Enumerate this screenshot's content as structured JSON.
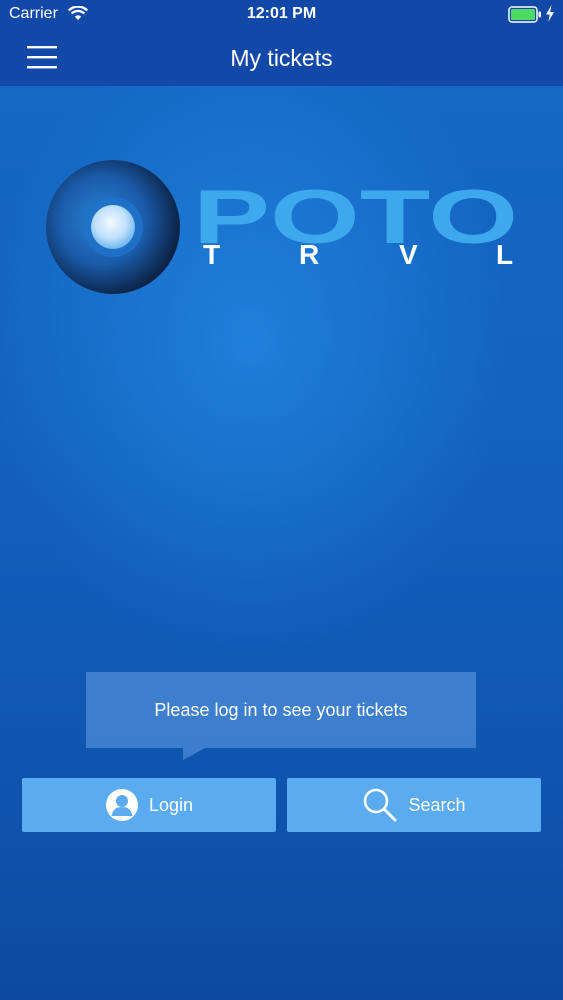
{
  "status_bar": {
    "carrier": "Carrier",
    "time": "12:01 PM"
  },
  "nav": {
    "title": "My tickets"
  },
  "logo": {
    "wordmark": "POTO",
    "letters": [
      "T",
      "R",
      "V",
      "L"
    ]
  },
  "tooltip": {
    "text": "Please log in to see your tickets"
  },
  "buttons": {
    "login_label": "Login",
    "search_label": "Search"
  },
  "icons": {
    "menu": "hamburger-icon",
    "login": "user-icon",
    "search": "magnifier-icon"
  },
  "colors": {
    "nav_bar": "#1248a8",
    "background": "#1363bf",
    "button": "#5aabf0",
    "logo_light": "#3ea8ec",
    "battery": "#4cd964"
  }
}
